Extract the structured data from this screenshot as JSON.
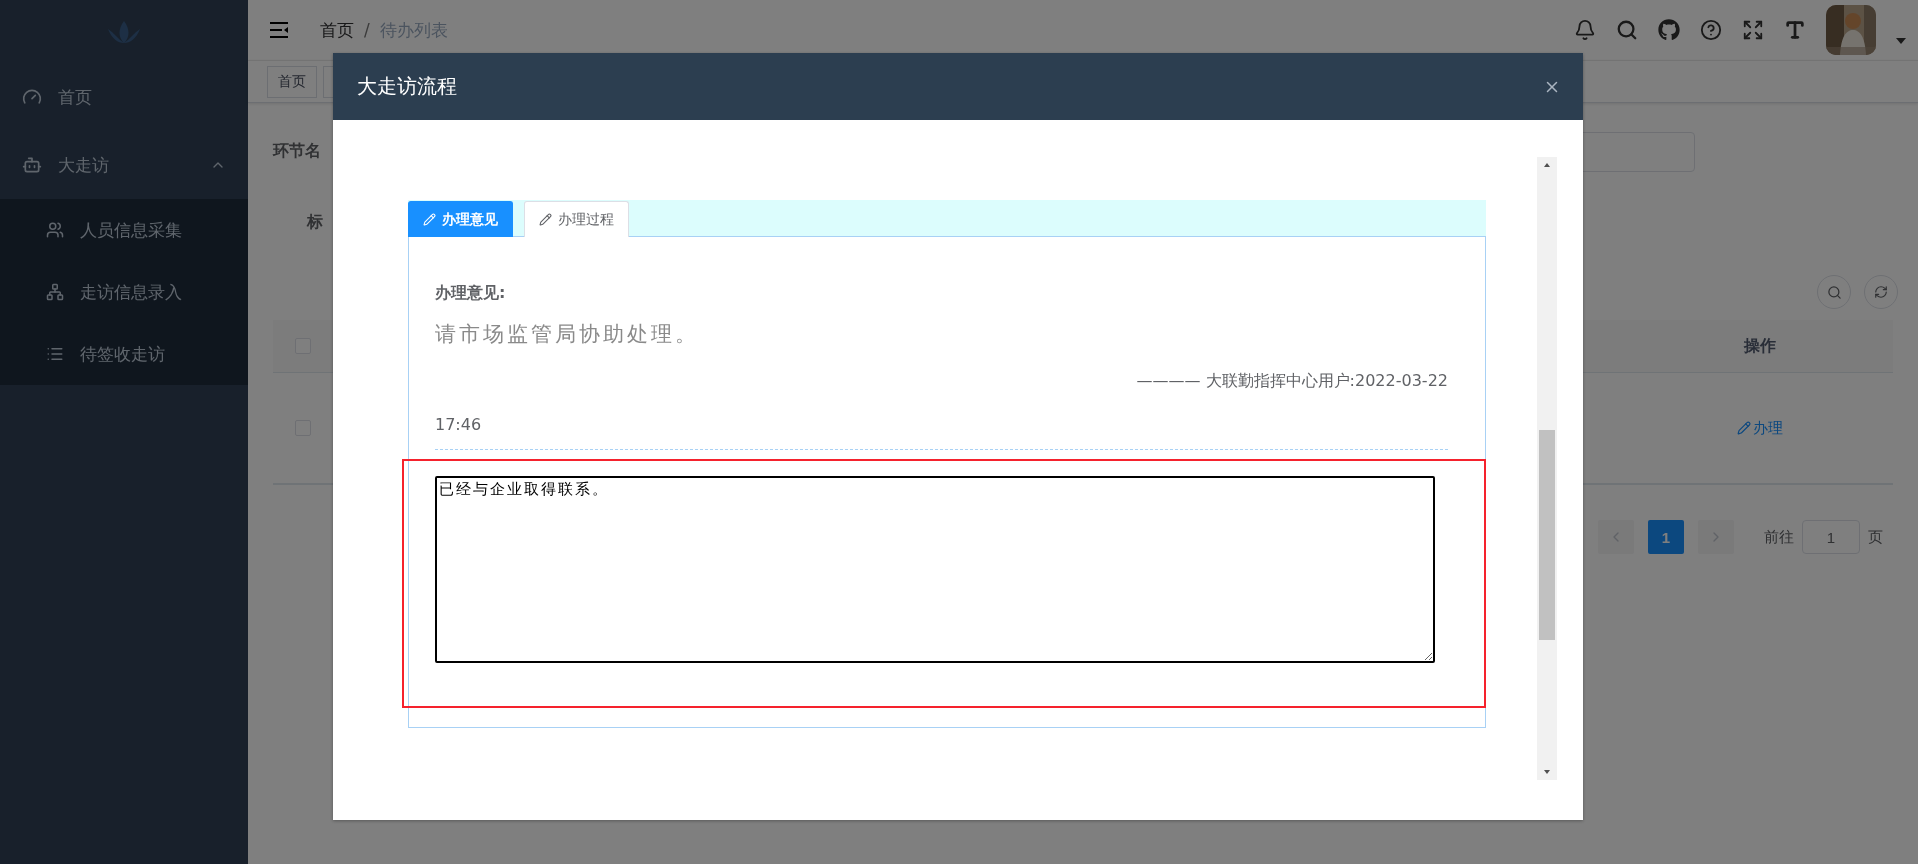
{
  "sidebar": {
    "items": [
      {
        "label": "首页"
      },
      {
        "label": "大走访",
        "expanded": true,
        "children": [
          {
            "label": "人员信息采集"
          },
          {
            "label": "走访信息录入"
          },
          {
            "label": "待签收走访"
          }
        ]
      }
    ]
  },
  "header": {
    "breadcrumb": [
      "首页",
      "待办列表"
    ],
    "separator": "/"
  },
  "tags": [
    "首页"
  ],
  "filters": [
    {
      "label": "环节名"
    },
    {
      "label": "标"
    }
  ],
  "table": {
    "columns": [
      {
        "label": "操作"
      }
    ],
    "header_checked": false,
    "rows": [
      {
        "checked": false,
        "action": "办理"
      }
    ]
  },
  "pagination": {
    "pages": [
      {
        "label": "1",
        "selected": true
      }
    ],
    "goto_label": "前往",
    "goto_value": "1",
    "page_suffix": "页"
  },
  "modal": {
    "title": "大走访流程",
    "tabs": [
      {
        "label": "办理意见",
        "selected": true
      },
      {
        "label": "办理过程",
        "selected": false
      }
    ],
    "opinion": {
      "heading": "办理意见:",
      "text": "请市场监管局协助处理。",
      "signature": "———— 大联勤指挥中心用户:2022-03-22",
      "time": "17:46"
    },
    "reply": {
      "value": "已经与企业取得联系。"
    }
  }
}
